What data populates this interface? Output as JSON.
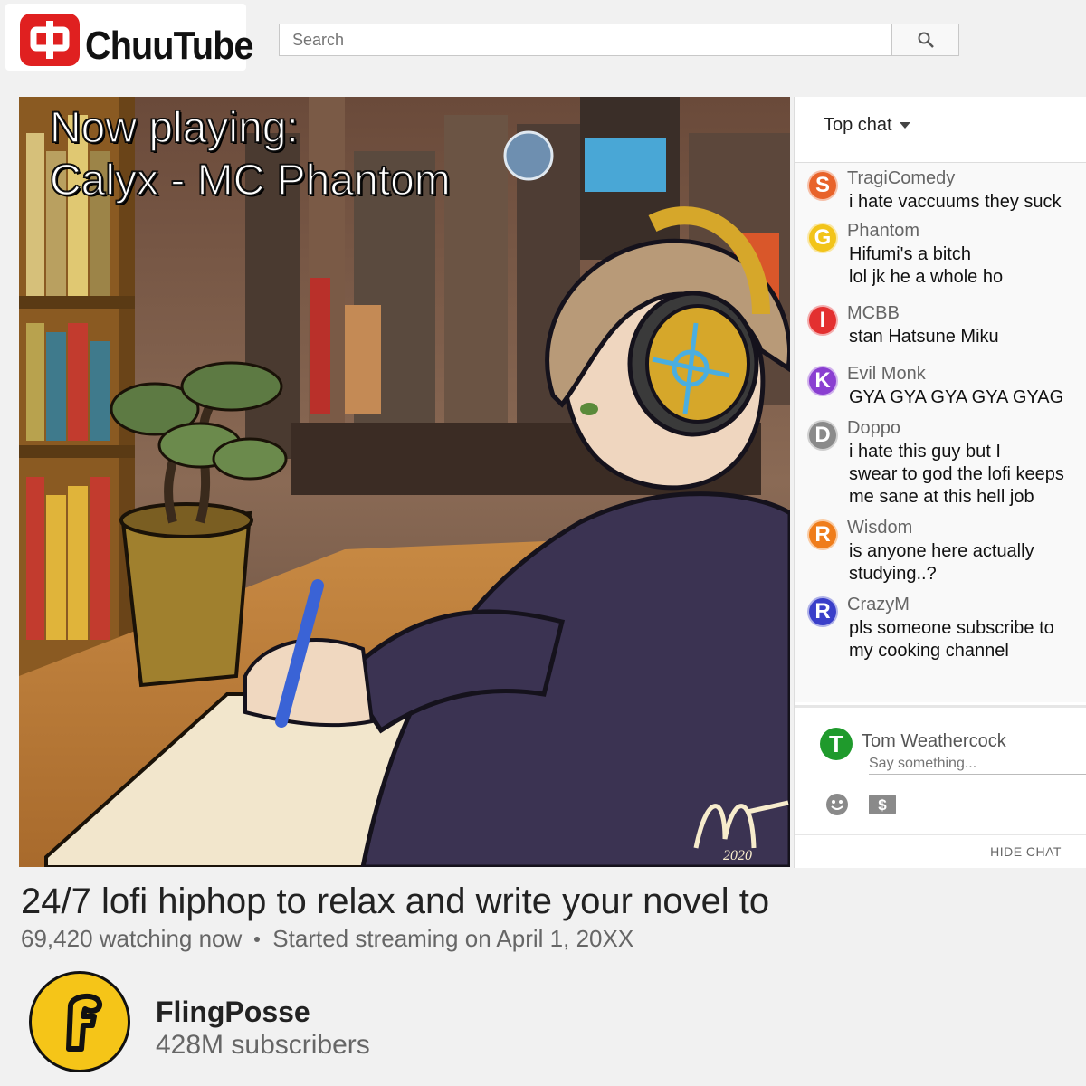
{
  "app": {
    "logo_text": "ChuuTube",
    "logo_glyph": "中",
    "brand_color": "#e02020"
  },
  "search": {
    "placeholder": "Search",
    "icon": "search-icon"
  },
  "player": {
    "overlay_line1": "Now playing:",
    "overlay_line2": "Calyx - MC Phantom",
    "signature_year": "2020"
  },
  "chat": {
    "mode_label": "Top chat",
    "messages": [
      {
        "initial": "S",
        "color": "#e8632a",
        "name": "TragiComedy",
        "lines": [
          "i hate vaccuums they suck"
        ]
      },
      {
        "initial": "G",
        "color": "#f2c41a",
        "name": "Phantom",
        "lines": [
          "Hifumi's a bitch",
          "lol jk he a whole ho"
        ]
      },
      {
        "initial": "I",
        "color": "#e33030",
        "name": "MCBB",
        "lines": [
          "stan Hatsune Miku"
        ]
      },
      {
        "initial": "K",
        "color": "#8a3fd1",
        "name": "Evil Monk",
        "lines": [
          "GYA  GYA GYA GYA GYAG"
        ]
      },
      {
        "initial": "D",
        "color": "#8a8a8a",
        "name": "Doppo",
        "lines": [
          "i hate this guy but I",
          "swear to god the lofi keeps",
          "me sane at this hell job"
        ]
      },
      {
        "initial": "R",
        "color": "#ef7d1b",
        "name": "Wisdom",
        "lines": [
          "is anyone here actually",
          "studying..?"
        ]
      },
      {
        "initial": "R",
        "color": "#3a3fc9",
        "name": "CrazyM",
        "lines": [
          "pls someone subscribe to",
          "my cooking channel"
        ]
      }
    ],
    "me": {
      "initial": "T",
      "color": "#1f9a2c",
      "name": "Tom Weathercock"
    },
    "input_placeholder": "Say something...",
    "hide_label": "HIDE CHAT"
  },
  "video": {
    "title": "24/7 lofi hiphop to relax and write your novel to",
    "watching": "69,420 watching now",
    "started": "Started streaming on April 1, 20XX"
  },
  "channel": {
    "name": "FlingPosse",
    "subscribers": "428M subscribers",
    "avatar_letter": "F",
    "avatar_color": "#f5c518"
  }
}
